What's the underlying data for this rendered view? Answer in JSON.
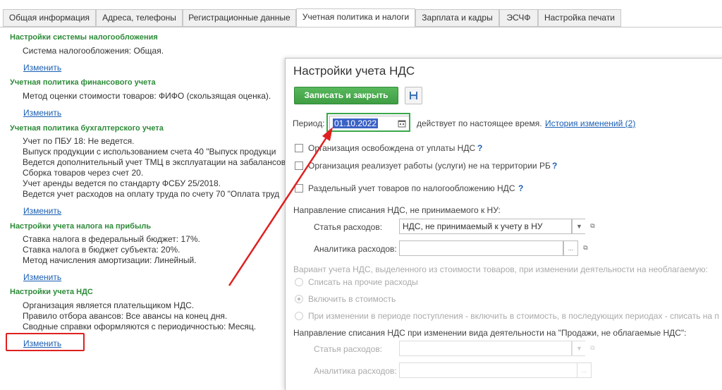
{
  "tabs": [
    {
      "label": "Общая информация"
    },
    {
      "label": "Адреса, телефоны"
    },
    {
      "label": "Регистрационные данные"
    },
    {
      "label": "Учетная политика и налоги"
    },
    {
      "label": "Зарплата и кадры"
    },
    {
      "label": "ЭСЧФ"
    },
    {
      "label": "Настройка печати"
    }
  ],
  "active_tab": "Учетная политика и налоги",
  "sections": [
    {
      "title": "Настройки системы налогообложения",
      "lines": [
        "Система налогообложения: Общая."
      ],
      "link": "Изменить"
    },
    {
      "title": "Учетная политика финансового учета",
      "lines": [
        "Метод оценки стоимости товаров: ФИФО (скользящая оценка)."
      ],
      "link": "Изменить"
    },
    {
      "title": "Учетная политика бухгалтерского учета",
      "lines": [
        "Учет по ПБУ 18: Не ведется.",
        "Выпуск продукции с использованием счета 40 \"Выпуск продукци",
        "Ведется дополнительный учет ТМЦ в эксплуатации на забалансов",
        "Сборка товаров через счет 20.",
        "Учет аренды ведется по стандарту ФСБУ 25/2018.",
        "Ведется учет расходов на оплату труда по счету 70 \"Оплата труд"
      ],
      "link": "Изменить"
    },
    {
      "title": "Настройки учета налога на прибыль",
      "lines": [
        "Ставка налога в федеральный бюджет: 17%.",
        "Ставка налога в бюджет субъекта: 20%.",
        "Метод начисления амортизации: Линейный."
      ],
      "link": "Изменить"
    },
    {
      "title": "Настройки учета НДС",
      "lines": [
        "Организация является плательщиком НДС.",
        "Правило отбора авансов: Все авансы на конец дня.",
        "Сводные справки оформляются с периодичностью: Месяц."
      ],
      "link": "Изменить"
    }
  ],
  "dialog": {
    "title": "Настройки учета НДС",
    "save_close_label": "Записать и закрыть",
    "period_label": "Период:",
    "period_value": "01.10.2022",
    "period_note": "действует по настоящее время.",
    "history_link": "История изменений (2)",
    "checkboxes": [
      {
        "label": "Организация освобождена от уплаты НДС",
        "checked": false,
        "help": "?"
      },
      {
        "label": "Организация реализует работы (услуги) не на территории РБ",
        "checked": false,
        "help": "?"
      },
      {
        "label": "Раздельный учет товаров по налогообложению НДС",
        "checked": false,
        "help": "?"
      }
    ],
    "group1_title": "Направление списания НДС, не принимаемого к НУ:",
    "expense_label": "Статья расходов:",
    "expense_value": "НДС, не принимаемый к учету в НУ",
    "analytics_label": "Аналитика расходов:",
    "analytics_value": "",
    "variant_title": "Вариант учета НДС, выделенного из стоимости товаров, при изменении деятельности на необлагаемую:",
    "radios": [
      {
        "label": "Списать на прочие расходы",
        "selected": false
      },
      {
        "label": "Включить в стоимость",
        "selected": true
      },
      {
        "label": "При изменении в периоде поступления - включить в стоимость, в последующих периодах - списать на п",
        "selected": false
      }
    ],
    "group2_title": "Направление списания НДС при изменении вида деятельности на \"Продажи, не облагаемые НДС\":",
    "expense2_label": "Статья расходов:",
    "analytics2_label": "Аналитика расходов:"
  },
  "icons": {
    "calendar": "calendar-icon",
    "save": "floppy-disk-icon",
    "dropdown": "triangle-down-icon",
    "open": "open-window-icon",
    "select": "ellipsis-icon"
  },
  "colors": {
    "section_title": "#2e8b3a",
    "link": "#1a5fb4",
    "primary_button": "#4caf50",
    "annotation_red": "#e02020",
    "annotation_green": "#3aa84a"
  }
}
